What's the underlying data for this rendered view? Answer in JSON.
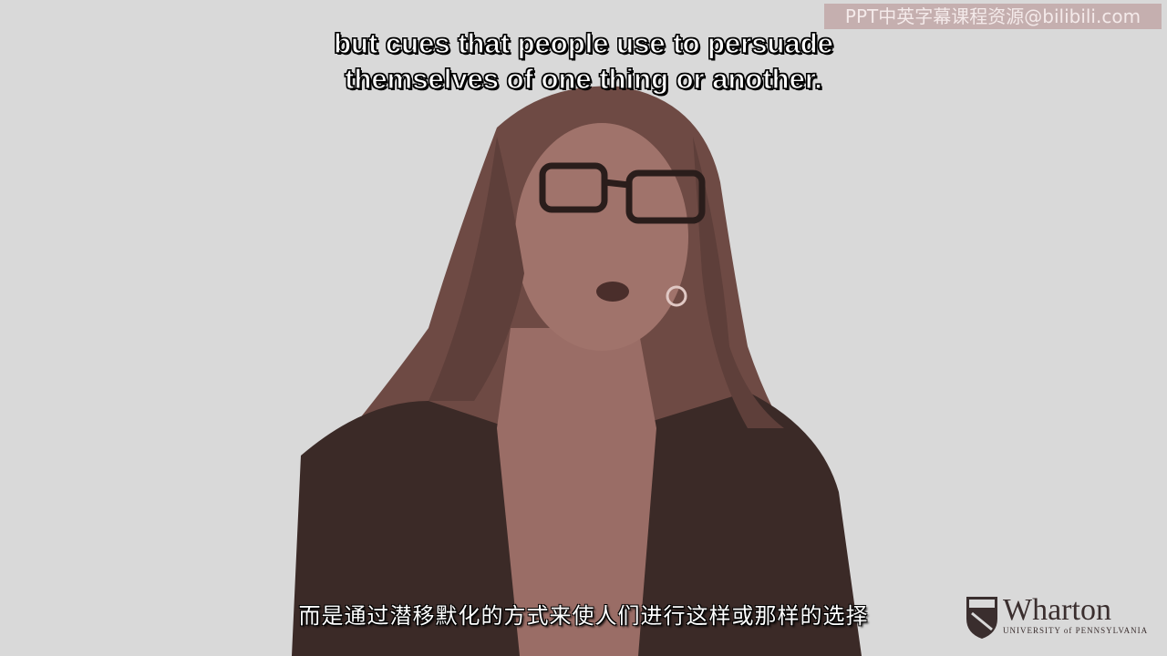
{
  "video": {
    "subtitle_en_line1": "but cues that people use to persuade",
    "subtitle_en_line2": "themselves of one thing or another.",
    "subtitle_zh": "而是通过潜移默化的方式来使人们进行这样或那样的选择",
    "watermark": "PPT中英字幕课程资源@bilibili.com"
  },
  "logo": {
    "name": "Wharton",
    "tagline": "UNIVERSITY of PENNSYLVANIA"
  },
  "colors": {
    "background": "#d9d9d9",
    "tint": "#8a5a52",
    "subtitle_text": "#ffffff"
  }
}
